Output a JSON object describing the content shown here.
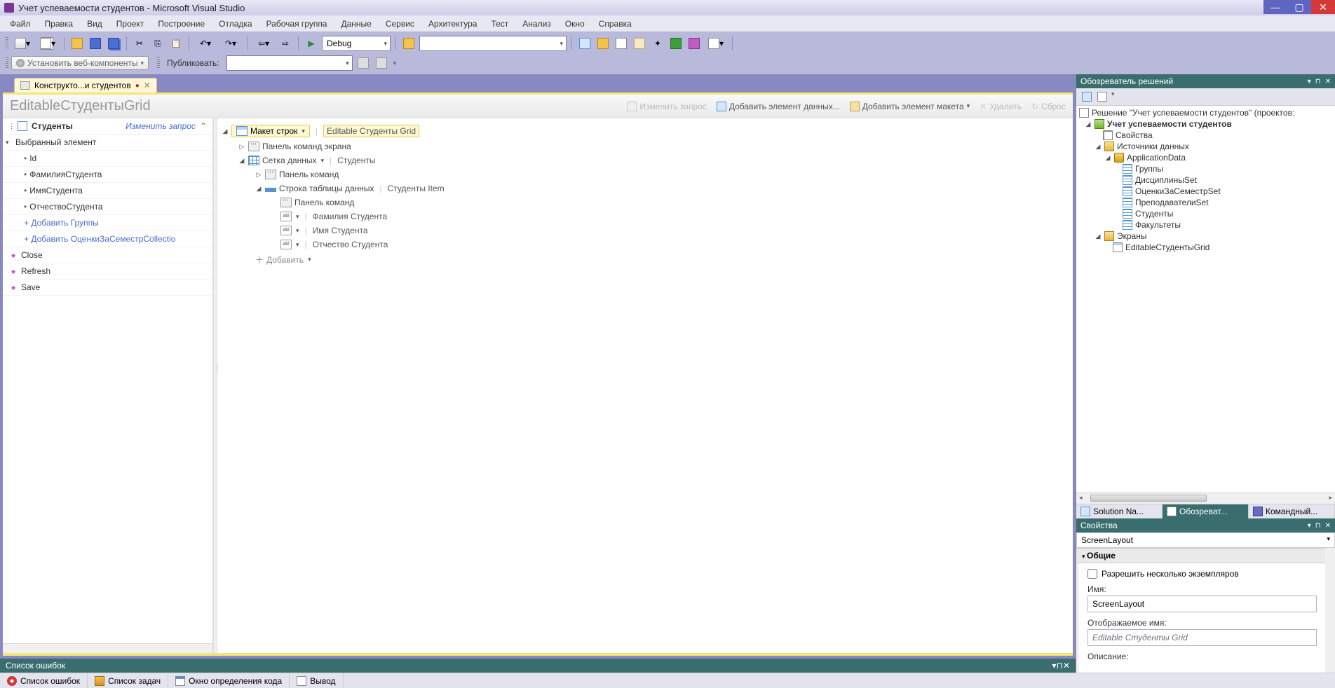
{
  "window": {
    "title": "Учет успеваемости студентов - Microsoft Visual Studio"
  },
  "menu": [
    "Файл",
    "Правка",
    "Вид",
    "Проект",
    "Построение",
    "Отладка",
    "Рабочая группа",
    "Данные",
    "Сервис",
    "Архитектура",
    "Тест",
    "Анализ",
    "Окно",
    "Справка"
  ],
  "toolbar": {
    "config": "Debug",
    "webComponents": "Установить веб-компоненты",
    "publishLabel": "Публиковать:"
  },
  "tab": {
    "label": "Конструкто...и студентов"
  },
  "screen": {
    "title": "EditableСтудентыGrid",
    "actions": {
      "editQuery": "Изменить запрос",
      "addDataItem": "Добавить элемент данных...",
      "addLayout": "Добавить элемент макета",
      "delete": "Удалить",
      "reset": "Сброс"
    }
  },
  "leftPanel": {
    "title": "Студенты",
    "editQuery": "Изменить запрос",
    "group": "Выбранный элемент",
    "items": [
      "Id",
      "ФамилияСтудента",
      "ИмяСтудента",
      "ОтчествоСтудента"
    ],
    "adds": [
      "+ Добавить Группы",
      "+ Добавить ОценкиЗаСеместрCollectio"
    ],
    "actions": [
      "Close",
      "Refresh",
      "Save"
    ]
  },
  "tree": {
    "rowLayout": "Макет строк",
    "rowLayoutSuffix": "Editable Студенты Grid",
    "screenCmdBar": "Панель команд экрана",
    "dataGrid": "Сетка данных",
    "dataGridSuffix": "Студенты",
    "cmdBar": "Панель команд",
    "tableRow": "Строка таблицы данных",
    "tableRowSuffix": "Студенты Item",
    "cmdBar2": "Панель команд",
    "fields": [
      "Фамилия Студента",
      "Имя Студента",
      "Отчество Студента"
    ],
    "add": "Добавить"
  },
  "solutionExplorer": {
    "title": "Обозреватель решений",
    "solution": "Решение \"Учет успеваемости студентов\"  (проектов:",
    "project": "Учет успеваемости студентов",
    "properties": "Свойства",
    "dataSources": "Источники данных",
    "appData": "ApplicationData",
    "tables": [
      "Группы",
      "ДисциплиныSet",
      "ОценкиЗаСеместрSet",
      "ПреподавателиSet",
      "Студенты",
      "Факультеты"
    ],
    "screens": "Экраны",
    "screenItem": "EditableСтудентыGrid",
    "tabs": [
      "Solution Na...",
      "Обозреват...",
      "Командный..."
    ]
  },
  "properties": {
    "title": "Свойства",
    "combo": "ScreenLayout",
    "section": "Общие",
    "allowMultiple": "Разрешить несколько экземпляров",
    "nameLabel": "Имя:",
    "nameValue": "ScreenLayout",
    "displayLabel": "Отображаемое имя:",
    "displayPlaceholder": "Editable Студенты Grid",
    "descLabel": "Описание:"
  },
  "errorList": {
    "title": "Список ошибок"
  },
  "bottomTabs": [
    "Список ошибок",
    "Список задач",
    "Окно определения кода",
    "Вывод"
  ]
}
